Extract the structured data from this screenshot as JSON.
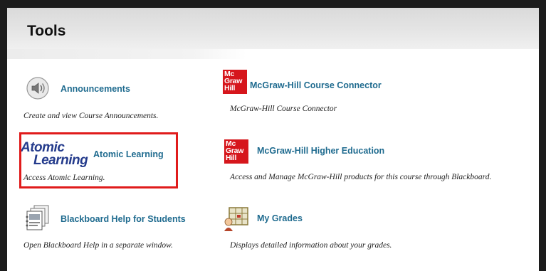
{
  "page": {
    "title": "Tools"
  },
  "colors": {
    "link": "#1f6b8f",
    "mh_red": "#d6161c",
    "highlight": "#e01b1b"
  },
  "tools": [
    {
      "name": "Announcements",
      "description": "Create and view Course Announcements.",
      "icon": "speaker-icon"
    },
    {
      "name": "McGraw-Hill Course Connector",
      "description": "McGraw-Hill Course Connector",
      "icon": "mcgraw-hill-logo"
    },
    {
      "name": "Atomic Learning",
      "description": "Access Atomic Learning.",
      "icon": "atomic-learning-logo",
      "logo_text": [
        "Atomic",
        "Learning"
      ]
    },
    {
      "name": "McGraw-Hill Higher Education",
      "description": "Access and Manage McGraw-Hill products for this course through Blackboard.",
      "icon": "mcgraw-hill-logo"
    },
    {
      "name": "Blackboard Help for Students",
      "description": "Open Blackboard Help in a separate window.",
      "icon": "help-document-icon"
    },
    {
      "name": "My Grades",
      "description": "Displays detailed information about your grades.",
      "icon": "grades-icon"
    }
  ],
  "mh_logo_text": [
    "Mc",
    "Graw",
    "Hill"
  ]
}
